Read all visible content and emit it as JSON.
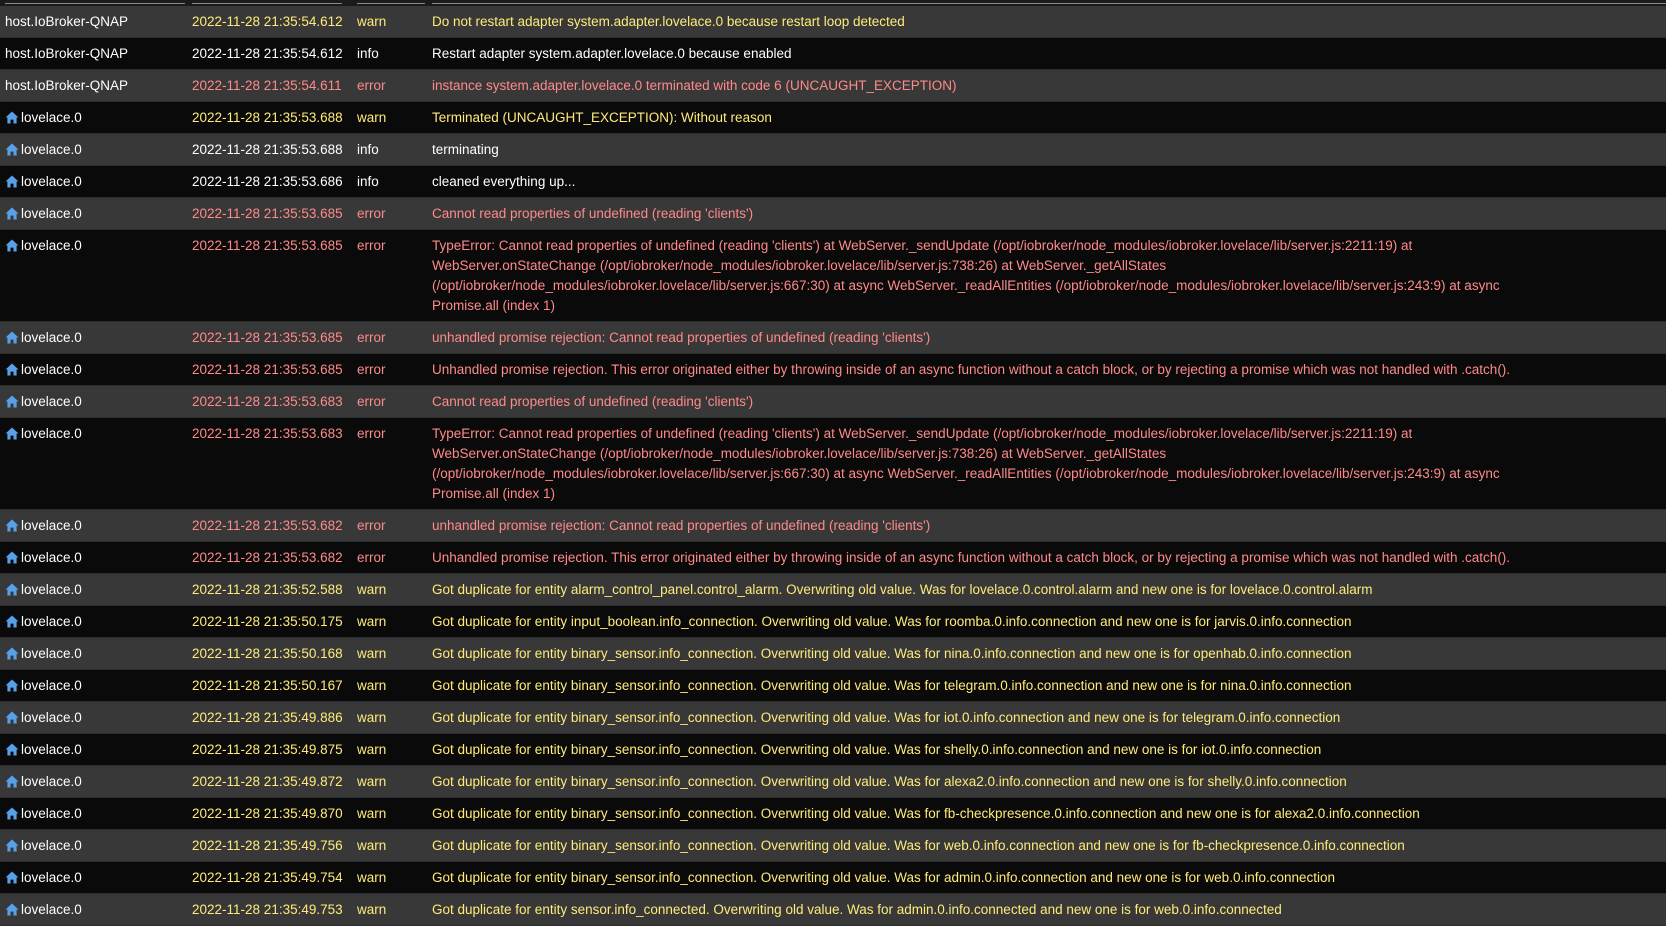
{
  "colors": {
    "warn": "#ffeb7a",
    "info": "#ffffff",
    "error": "#ff8a8a",
    "row_even": "#383838",
    "row_odd": "#0a0a0a",
    "adapter_icon": "#5aa0e8"
  },
  "log": {
    "rows": [
      {
        "source": "host.IoBroker-QNAP",
        "icon": "",
        "time": "2022-11-28 21:35:54.612",
        "severity": "warn",
        "message": "Do not restart adapter system.adapter.lovelace.0 because restart loop detected"
      },
      {
        "source": "host.IoBroker-QNAP",
        "icon": "",
        "time": "2022-11-28 21:35:54.612",
        "severity": "info",
        "message": "Restart adapter system.adapter.lovelace.0 because enabled"
      },
      {
        "source": "host.IoBroker-QNAP",
        "icon": "",
        "time": "2022-11-28 21:35:54.611",
        "severity": "error",
        "message": "instance system.adapter.lovelace.0 terminated with code 6 (UNCAUGHT_EXCEPTION)"
      },
      {
        "source": "lovelace.0",
        "icon": "house-icon",
        "time": "2022-11-28 21:35:53.688",
        "severity": "warn",
        "message": "Terminated (UNCAUGHT_EXCEPTION): Without reason"
      },
      {
        "source": "lovelace.0",
        "icon": "house-icon",
        "time": "2022-11-28 21:35:53.688",
        "severity": "info",
        "message": "terminating"
      },
      {
        "source": "lovelace.0",
        "icon": "house-icon",
        "time": "2022-11-28 21:35:53.686",
        "severity": "info",
        "message": "cleaned everything up..."
      },
      {
        "source": "lovelace.0",
        "icon": "house-icon",
        "time": "2022-11-28 21:35:53.685",
        "severity": "error",
        "message": "Cannot read properties of undefined (reading 'clients')"
      },
      {
        "source": "lovelace.0",
        "icon": "house-icon",
        "time": "2022-11-28 21:35:53.685",
        "severity": "error",
        "message": "TypeError: Cannot read properties of undefined (reading 'clients') at WebServer._sendUpdate (/opt/iobroker/node_modules/iobroker.lovelace/lib/server.js:2211:19) at WebServer.onStateChange (/opt/iobroker/node_modules/iobroker.lovelace/lib/server.js:738:26) at WebServer._getAllStates (/opt/iobroker/node_modules/iobroker.lovelace/lib/server.js:667:30) at async WebServer._readAllEntities (/opt/iobroker/node_modules/iobroker.lovelace/lib/server.js:243:9) at async Promise.all (index 1)"
      },
      {
        "source": "lovelace.0",
        "icon": "house-icon",
        "time": "2022-11-28 21:35:53.685",
        "severity": "error",
        "message": "unhandled promise rejection: Cannot read properties of undefined (reading 'clients')"
      },
      {
        "source": "lovelace.0",
        "icon": "house-icon",
        "time": "2022-11-28 21:35:53.685",
        "severity": "error",
        "message": "Unhandled promise rejection. This error originated either by throwing inside of an async function without a catch block, or by rejecting a promise which was not handled with .catch()."
      },
      {
        "source": "lovelace.0",
        "icon": "house-icon",
        "time": "2022-11-28 21:35:53.683",
        "severity": "error",
        "message": "Cannot read properties of undefined (reading 'clients')"
      },
      {
        "source": "lovelace.0",
        "icon": "house-icon",
        "time": "2022-11-28 21:35:53.683",
        "severity": "error",
        "message": "TypeError: Cannot read properties of undefined (reading 'clients') at WebServer._sendUpdate (/opt/iobroker/node_modules/iobroker.lovelace/lib/server.js:2211:19) at WebServer.onStateChange (/opt/iobroker/node_modules/iobroker.lovelace/lib/server.js:738:26) at WebServer._getAllStates (/opt/iobroker/node_modules/iobroker.lovelace/lib/server.js:667:30) at async WebServer._readAllEntities (/opt/iobroker/node_modules/iobroker.lovelace/lib/server.js:243:9) at async Promise.all (index 1)"
      },
      {
        "source": "lovelace.0",
        "icon": "house-icon",
        "time": "2022-11-28 21:35:53.682",
        "severity": "error",
        "message": "unhandled promise rejection: Cannot read properties of undefined (reading 'clients')"
      },
      {
        "source": "lovelace.0",
        "icon": "house-icon",
        "time": "2022-11-28 21:35:53.682",
        "severity": "error",
        "message": "Unhandled promise rejection. This error originated either by throwing inside of an async function without a catch block, or by rejecting a promise which was not handled with .catch()."
      },
      {
        "source": "lovelace.0",
        "icon": "house-icon",
        "time": "2022-11-28 21:35:52.588",
        "severity": "warn",
        "message": "Got duplicate for entity alarm_control_panel.control_alarm. Overwriting old value. Was for lovelace.0.control.alarm and new one is for lovelace.0.control.alarm"
      },
      {
        "source": "lovelace.0",
        "icon": "house-icon",
        "time": "2022-11-28 21:35:50.175",
        "severity": "warn",
        "message": "Got duplicate for entity input_boolean.info_connection. Overwriting old value. Was for roomba.0.info.connection and new one is for jarvis.0.info.connection"
      },
      {
        "source": "lovelace.0",
        "icon": "house-icon",
        "time": "2022-11-28 21:35:50.168",
        "severity": "warn",
        "message": "Got duplicate for entity binary_sensor.info_connection. Overwriting old value. Was for nina.0.info.connection and new one is for openhab.0.info.connection"
      },
      {
        "source": "lovelace.0",
        "icon": "house-icon",
        "time": "2022-11-28 21:35:50.167",
        "severity": "warn",
        "message": "Got duplicate for entity binary_sensor.info_connection. Overwriting old value. Was for telegram.0.info.connection and new one is for nina.0.info.connection"
      },
      {
        "source": "lovelace.0",
        "icon": "house-icon",
        "time": "2022-11-28 21:35:49.886",
        "severity": "warn",
        "message": "Got duplicate for entity binary_sensor.info_connection. Overwriting old value. Was for iot.0.info.connection and new one is for telegram.0.info.connection"
      },
      {
        "source": "lovelace.0",
        "icon": "house-icon",
        "time": "2022-11-28 21:35:49.875",
        "severity": "warn",
        "message": "Got duplicate for entity binary_sensor.info_connection. Overwriting old value. Was for shelly.0.info.connection and new one is for iot.0.info.connection"
      },
      {
        "source": "lovelace.0",
        "icon": "house-icon",
        "time": "2022-11-28 21:35:49.872",
        "severity": "warn",
        "message": "Got duplicate for entity binary_sensor.info_connection. Overwriting old value. Was for alexa2.0.info.connection and new one is for shelly.0.info.connection"
      },
      {
        "source": "lovelace.0",
        "icon": "house-icon",
        "time": "2022-11-28 21:35:49.870",
        "severity": "warn",
        "message": "Got duplicate for entity binary_sensor.info_connection. Overwriting old value. Was for fb-checkpresence.0.info.connection and new one is for alexa2.0.info.connection"
      },
      {
        "source": "lovelace.0",
        "icon": "house-icon",
        "time": "2022-11-28 21:35:49.756",
        "severity": "warn",
        "message": "Got duplicate for entity binary_sensor.info_connection. Overwriting old value. Was for web.0.info.connection and new one is for fb-checkpresence.0.info.connection"
      },
      {
        "source": "lovelace.0",
        "icon": "house-icon",
        "time": "2022-11-28 21:35:49.754",
        "severity": "warn",
        "message": "Got duplicate for entity binary_sensor.info_connection. Overwriting old value. Was for admin.0.info.connection and new one is for web.0.info.connection"
      },
      {
        "source": "lovelace.0",
        "icon": "house-icon",
        "time": "2022-11-28 21:35:49.753",
        "severity": "warn",
        "message": "Got duplicate for entity sensor.info_connected. Overwriting old value. Was for admin.0.info.connected and new one is for web.0.info.connected"
      }
    ]
  }
}
